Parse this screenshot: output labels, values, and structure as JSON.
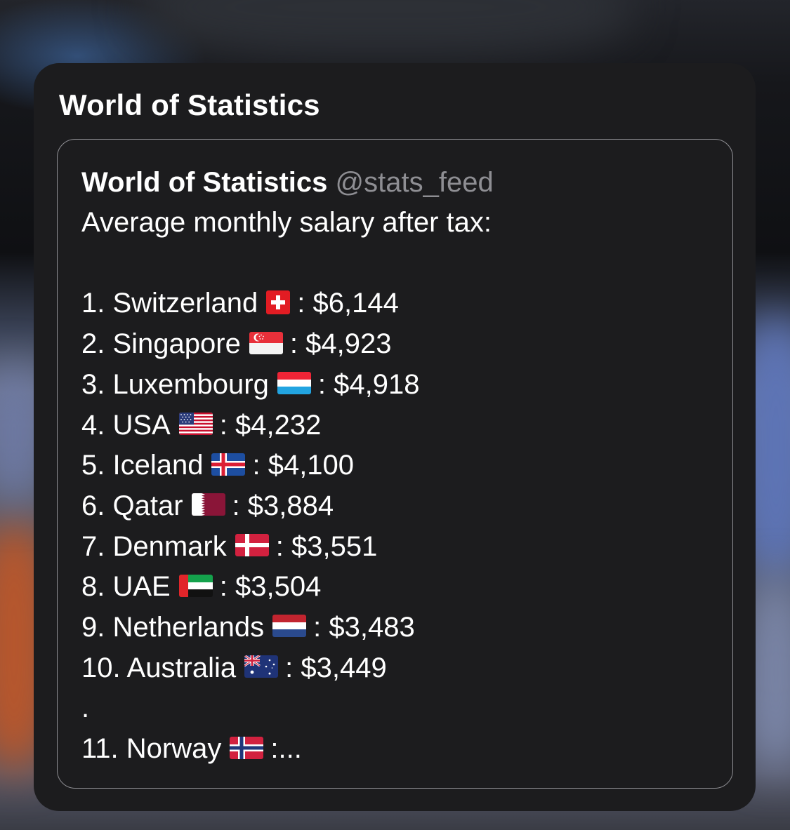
{
  "card": {
    "title": "World of Statistics"
  },
  "tweet": {
    "author_name": "World of Statistics",
    "author_handle": "@stats_feed",
    "intro": "Average monthly salary after tax:",
    "entries": [
      {
        "rank": "1.",
        "country": "Switzerland",
        "flag_icon": "switzerland-flag-icon",
        "value": "$6,144"
      },
      {
        "rank": "2.",
        "country": "Singapore",
        "flag_icon": "singapore-flag-icon",
        "value": "$4,923"
      },
      {
        "rank": "3.",
        "country": "Luxembourg",
        "flag_icon": "luxembourg-flag-icon",
        "value": "$4,918"
      },
      {
        "rank": "4.",
        "country": "USA",
        "flag_icon": "usa-flag-icon",
        "value": "$4,232"
      },
      {
        "rank": "5.",
        "country": "Iceland",
        "flag_icon": "iceland-flag-icon",
        "value": "$4,100"
      },
      {
        "rank": "6.",
        "country": "Qatar",
        "flag_icon": "qatar-flag-icon",
        "value": "$3,884"
      },
      {
        "rank": "7.",
        "country": "Denmark",
        "flag_icon": "denmark-flag-icon",
        "value": "$3,551"
      },
      {
        "rank": "8.",
        "country": "UAE",
        "flag_icon": "uae-flag-icon",
        "value": "$3,504"
      },
      {
        "rank": "9.",
        "country": "Netherlands",
        "flag_icon": "netherlands-flag-icon",
        "value": "$3,483"
      },
      {
        "rank": "10.",
        "country": "Australia",
        "flag_icon": "australia-flag-icon",
        "value": "$3,449"
      }
    ],
    "separator": ".",
    "last_entry": {
      "rank": "11.",
      "country": "Norway",
      "flag_icon": "norway-flag-icon",
      "value": ":..."
    }
  },
  "colors": {
    "card_background": "#1c1c1e",
    "text_primary": "#ffffff",
    "text_secondary": "#8e8e93",
    "border": "#8e8e93"
  }
}
